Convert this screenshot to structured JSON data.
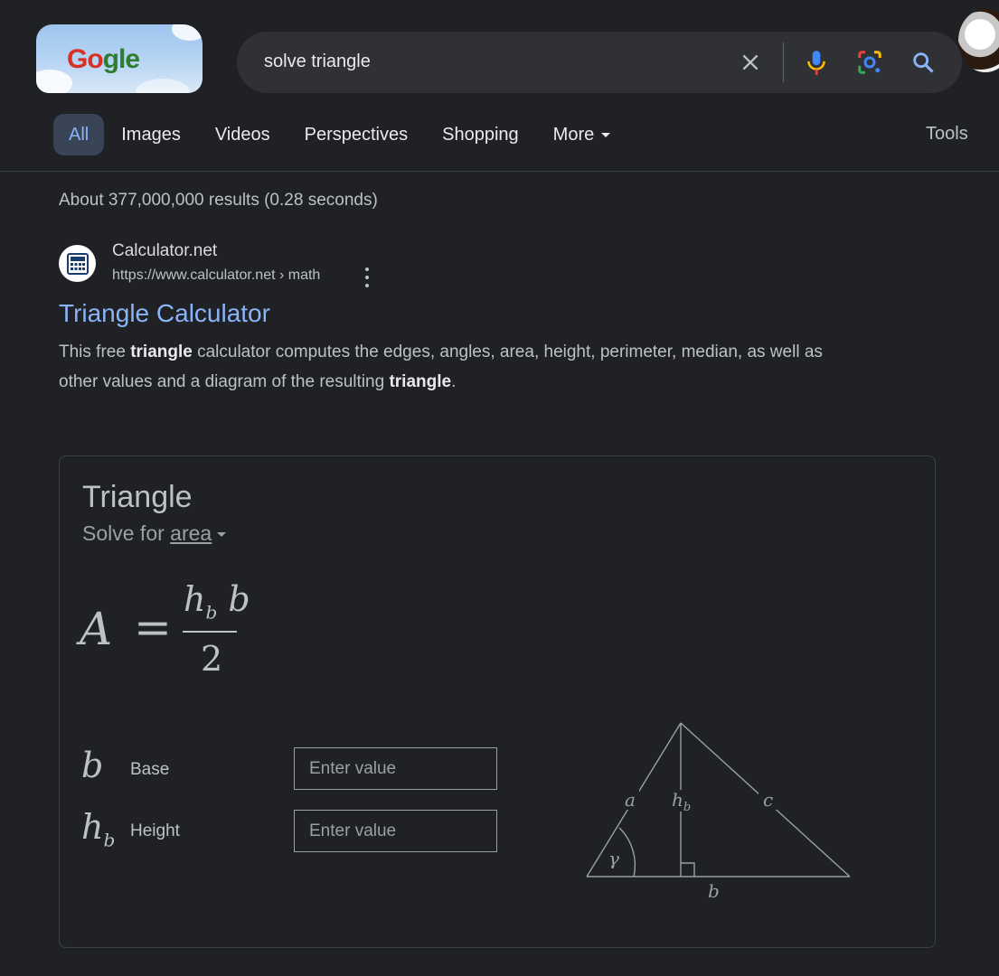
{
  "logo": {
    "alt": "Google Doodle",
    "letters": [
      "G",
      "o",
      "gle"
    ]
  },
  "search": {
    "query": "solve triangle",
    "icons": [
      "clear-icon",
      "microphone-icon",
      "lens-icon",
      "search-icon"
    ]
  },
  "tabs": [
    {
      "label": "All",
      "active": true
    },
    {
      "label": "Images"
    },
    {
      "label": "Videos"
    },
    {
      "label": "Perspectives"
    },
    {
      "label": "Shopping"
    },
    {
      "label": "More"
    }
  ],
  "tools_label": "Tools",
  "stats": "About 377,000,000 results (0.28 seconds)",
  "result": {
    "site_name": "Calculator.net",
    "url": "https://www.calculator.net › math",
    "title": "Triangle Calculator",
    "snippet": {
      "p1": "This free ",
      "b1": "triangle",
      "p2": " calculator computes the edges, angles, area, height, perimeter, median, as well as other values and a diagram of the resulting ",
      "b2": "triangle",
      "p3": "."
    }
  },
  "calculator": {
    "title": "Triangle",
    "solve_for_prefix": "Solve for ",
    "solve_for_value": "area",
    "formula": {
      "lhs": "A",
      "eq": "=",
      "num_h": "h",
      "num_sub": "b",
      "num_b": " b",
      "den": "2"
    },
    "inputs": [
      {
        "symbol": "b",
        "sub": "",
        "label": "Base",
        "placeholder": "Enter value"
      },
      {
        "symbol": "h",
        "sub": "b",
        "label": "Height",
        "placeholder": "Enter value"
      }
    ],
    "diagram_labels": {
      "a": "a",
      "hb": "h",
      "hb_sub": "b",
      "c": "c",
      "b": "b",
      "gamma": "γ"
    }
  }
}
